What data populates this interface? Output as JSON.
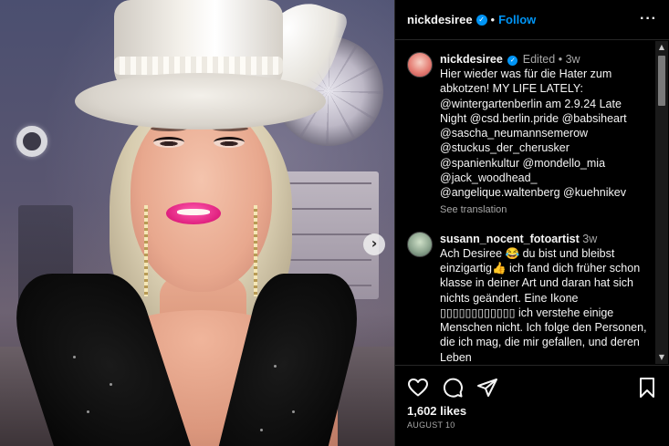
{
  "post": {
    "username": "nickdesiree",
    "verified_mark": "✓",
    "separator": "•",
    "follow_label": "Follow",
    "more_label": "···",
    "carousel_next": "›"
  },
  "caption": {
    "username": "nickdesiree",
    "edited_label": "Edited",
    "bullet": "•",
    "time": "3w",
    "text": "Hier wieder was für die Hater zum abkotzen! MY LIFE LATELY: @wintergartenberlin am 2.9.24 Late Night @csd.berlin.pride @babsiheart @sascha_neumannsemerow @stuckus_der_cherusker @spanienkultur @mondello_mia @jack_woodhead_ @angelique.waltenberg @kuehnikev",
    "see_translation": "See translation"
  },
  "comments": [
    {
      "username": "susann_nocent_fotoartist",
      "time": "3w",
      "text": "Ach Desiree 😂 du bist und bleibst einzigartig👍 ich fand dich früher schon klasse in deiner Art und daran hat sich nichts geändert. Eine Ikone ▯▯▯▯▯▯▯▯▯▯▯▯ ich verstehe einige Menschen nicht. Ich folge den Personen, die ich mag, die mir gefallen, und deren Leben"
    }
  ],
  "actions": {
    "like_icon": "heart-icon",
    "comment_icon": "comment-icon",
    "share_icon": "share-icon",
    "save_icon": "bookmark-icon"
  },
  "likes": "1,602 likes",
  "date": "AUGUST 10",
  "scrollbar": {
    "up": "▲",
    "down": "▼"
  },
  "colors": {
    "accent": "#0095f6",
    "background": "#000000",
    "text": "#f5f5f5",
    "muted": "#a8a8a8"
  }
}
